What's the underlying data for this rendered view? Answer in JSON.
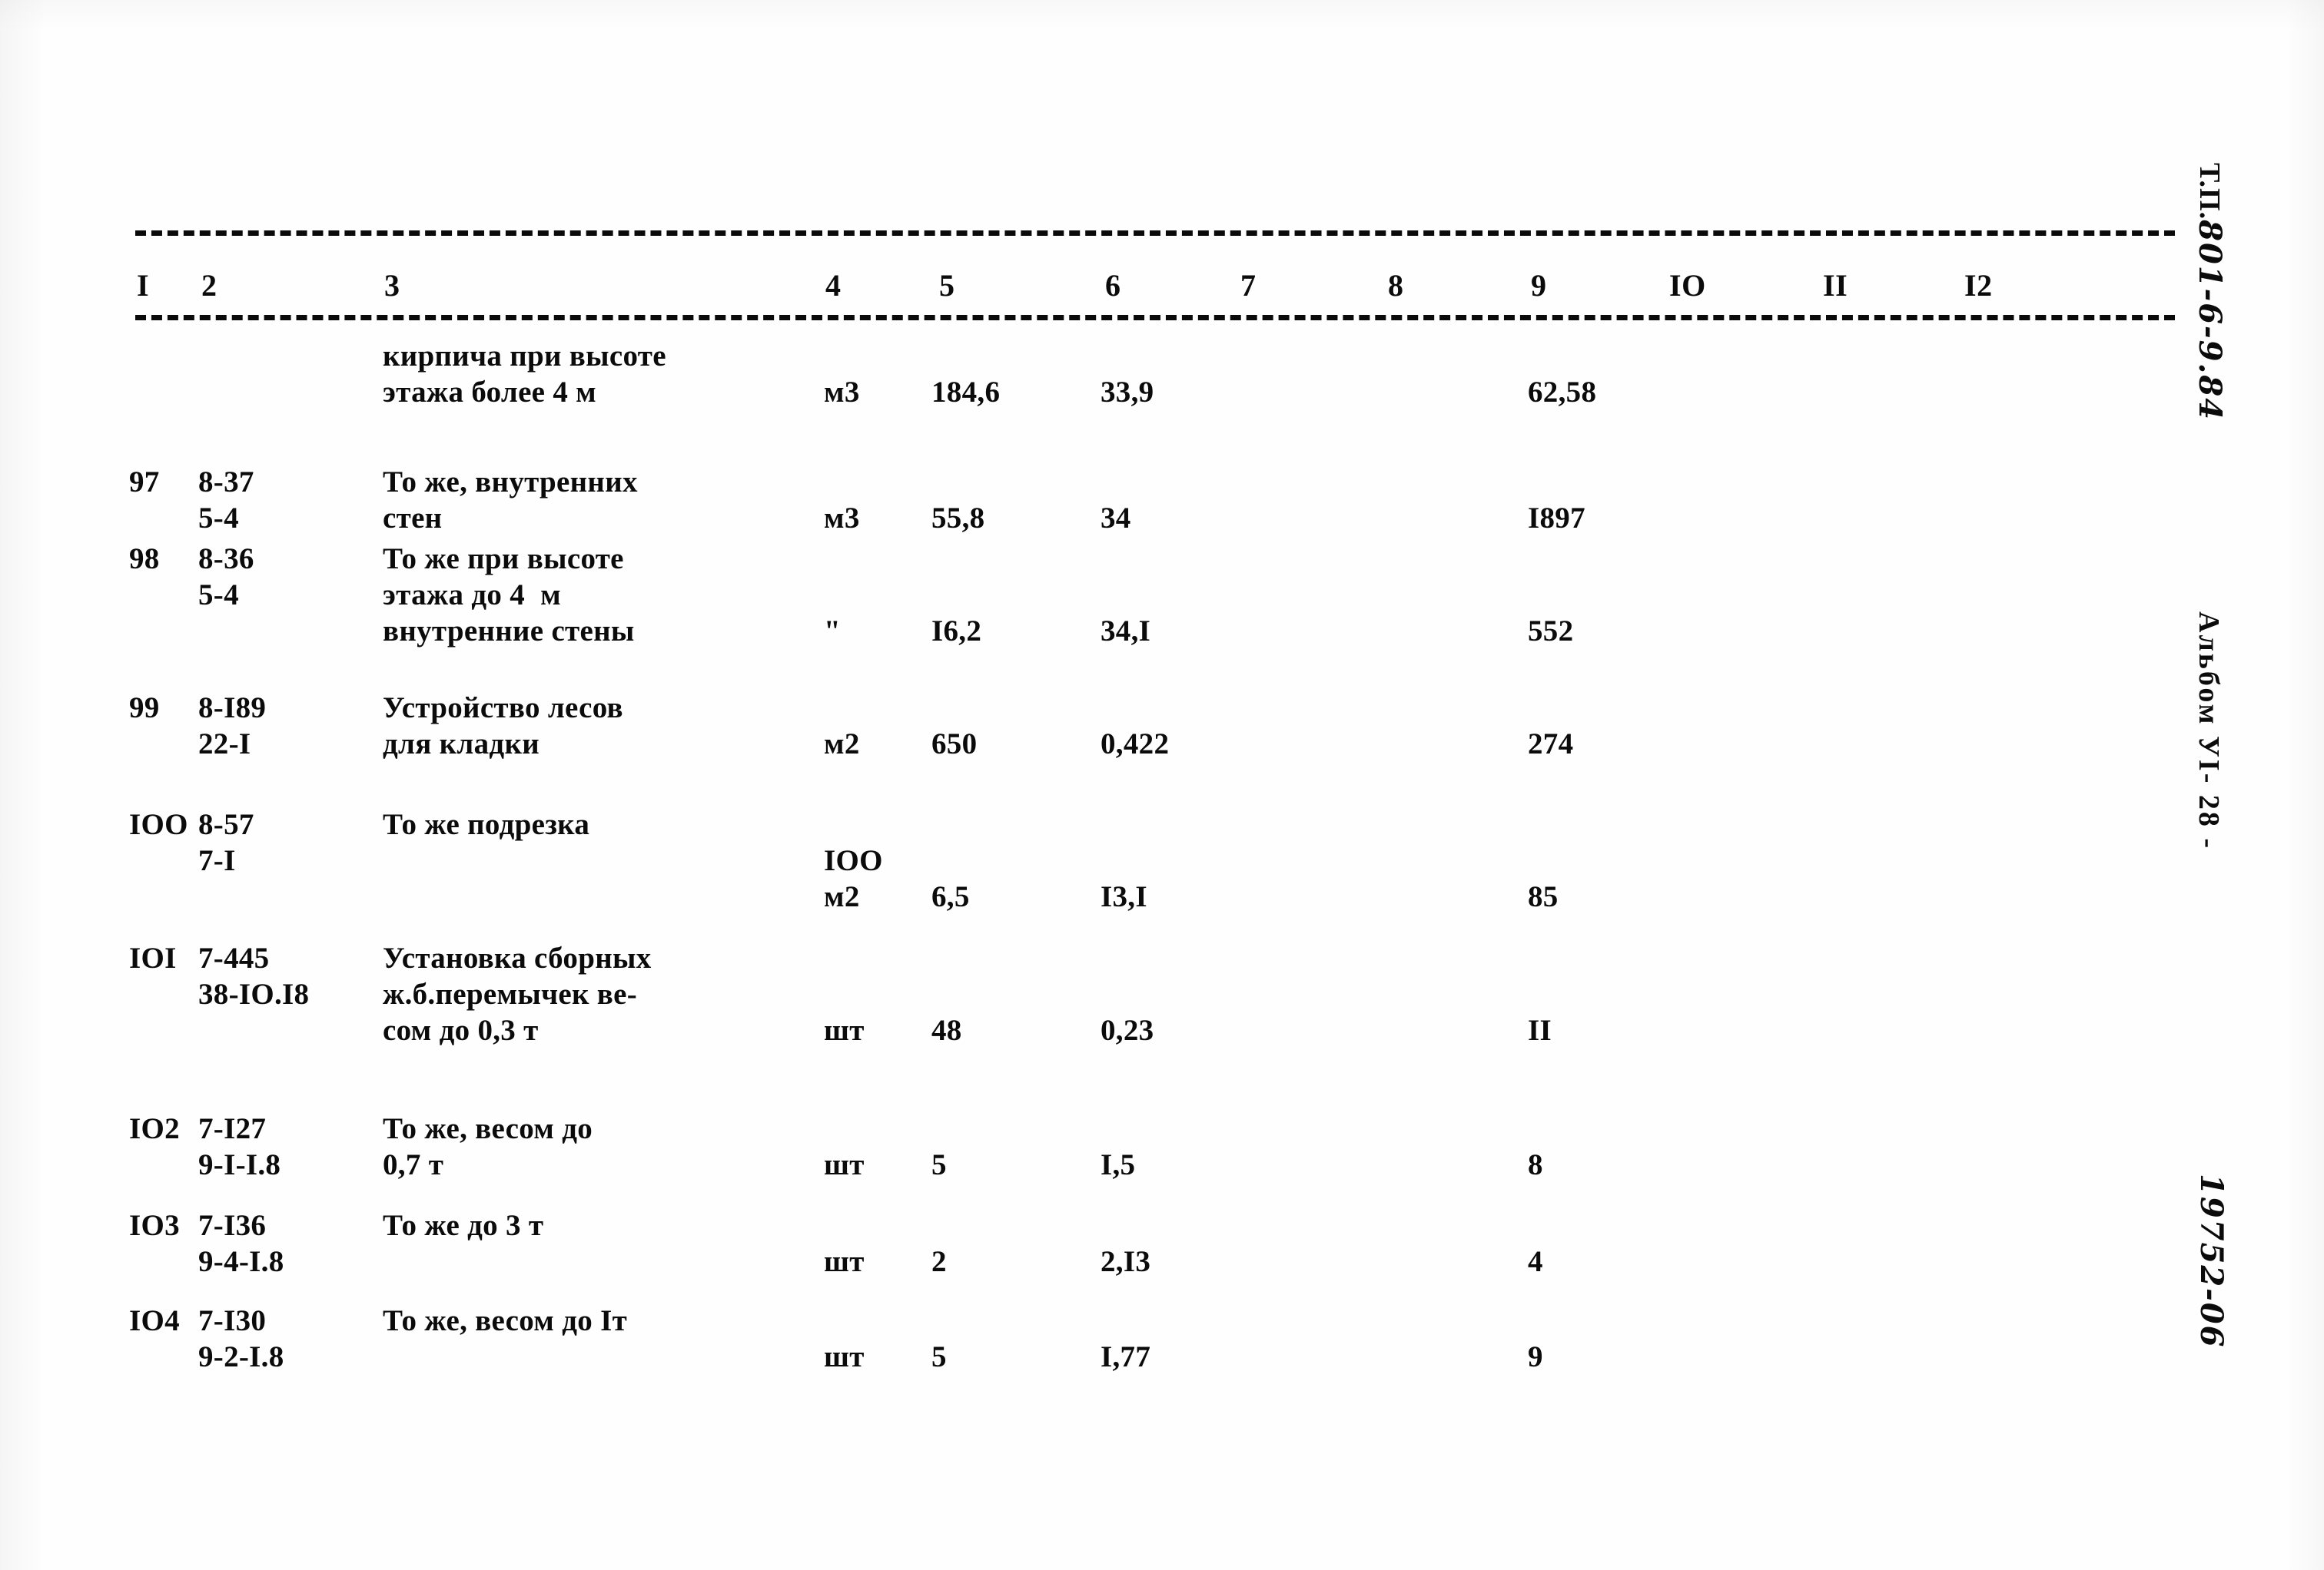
{
  "document": {
    "kind": "scanned-typewritten-estimate-table"
  },
  "table": {
    "column_headers": [
      "I",
      "2",
      "3",
      "4",
      "5",
      "6",
      "7",
      "8",
      "9",
      "IO",
      "II",
      "I2"
    ],
    "rows": [
      {
        "num": "",
        "code": "",
        "desc": [
          "кирпича при высоте",
          "этажа более 4 м"
        ],
        "unit": "м3",
        "qty": "184,6",
        "norm": "33,9",
        "sum": "62,58"
      },
      {
        "num": "97",
        "code": [
          "8-37",
          "5-4"
        ],
        "desc": [
          "То же, внутренних",
          "стен"
        ],
        "unit": "м3",
        "qty": "55,8",
        "norm": "34",
        "sum": "I897"
      },
      {
        "num": "98",
        "code": [
          "8-36",
          "5-4"
        ],
        "desc": [
          "То же при высоте",
          "этажа до 4  м",
          "внутренние стены"
        ],
        "unit": "\"",
        "qty": "I6,2",
        "norm": "34,I",
        "sum": "552"
      },
      {
        "num": "99",
        "code": [
          "8-I89",
          "22-I"
        ],
        "desc": [
          "Устройство лесов",
          "для кладки"
        ],
        "unit": "м2",
        "qty": "650",
        "norm": "0,422",
        "sum": "274"
      },
      {
        "num": "IOO",
        "code": [
          "8-57",
          "7-I"
        ],
        "desc": [
          "То же подрезка"
        ],
        "unit": [
          "IOO",
          "м2"
        ],
        "qty": "6,5",
        "norm": "I3,I",
        "sum": "85"
      },
      {
        "num": "IOI",
        "code": [
          "7-445",
          "38-IO.I8"
        ],
        "desc": [
          "Установка сборных",
          "ж.б.перемычек ве-",
          "сом до 0,3 т"
        ],
        "unit": "шт",
        "qty": "48",
        "norm": "0,23",
        "sum": "II"
      },
      {
        "num": "IO2",
        "code": [
          "7-I27",
          "9-I-I.8"
        ],
        "desc": [
          "То же, весом до",
          "0,7 т"
        ],
        "unit": "шт",
        "qty": "5",
        "norm": "I,5",
        "sum": "8"
      },
      {
        "num": "IO3",
        "code": [
          "7-I36",
          "9-4-I.8"
        ],
        "desc": [
          "То же до 3 т"
        ],
        "unit": "шт",
        "qty": "2",
        "norm": "2,I3",
        "sum": "4"
      },
      {
        "num": "IO4",
        "code": [
          "7-I30",
          "9-2-I.8"
        ],
        "desc": [
          "То же, весом до Iт"
        ],
        "unit": "шт",
        "qty": "5",
        "norm": "I,77",
        "sum": "9"
      }
    ]
  },
  "margin": {
    "project_prefix": "Т.П.",
    "project_code": "801-6-9.84",
    "album": "Альбом УI",
    "page": "- 28 -",
    "archive_number": "19752-06"
  },
  "colors": {
    "ink": "#0b0b0b",
    "paper": "#fefefe"
  }
}
